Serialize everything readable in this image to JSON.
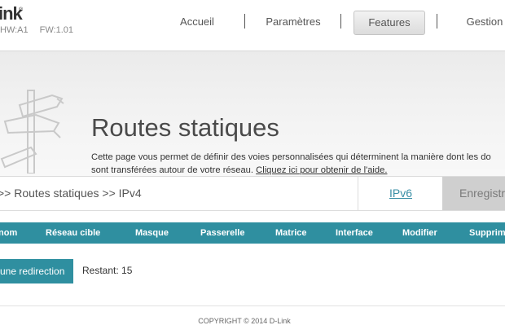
{
  "header": {
    "brand": "ink",
    "reg": "®",
    "hw": "HW:A1",
    "fw": "FW:1.01",
    "nav": [
      "Accueil",
      "Paramètres",
      "Features",
      "Gestion"
    ]
  },
  "banner": {
    "title": "Routes statiques",
    "desc_line1": "Cette page vous permet de définir des voies personnalisées qui déterminent la manière dont les do",
    "desc_line2_text": "sont transférées autour de votre réseau.",
    "help_link": "Cliquez ici pour obtenir de l'aide."
  },
  "breadcrumb": {
    "text": ">> Routes statiques >> IPv4",
    "ipv6_tab": "IPv6",
    "save": "Enregistr"
  },
  "table": {
    "columns": [
      "nom",
      "Réseau cible",
      "Masque",
      "Passerelle",
      "Matrice",
      "Interface",
      "Modifier",
      "Supprim"
    ]
  },
  "actions": {
    "add_label": "une redirection",
    "remaining": "Restant: 15"
  },
  "footer": {
    "copyright": "COPYRIGHT © 2014 D-Link"
  }
}
